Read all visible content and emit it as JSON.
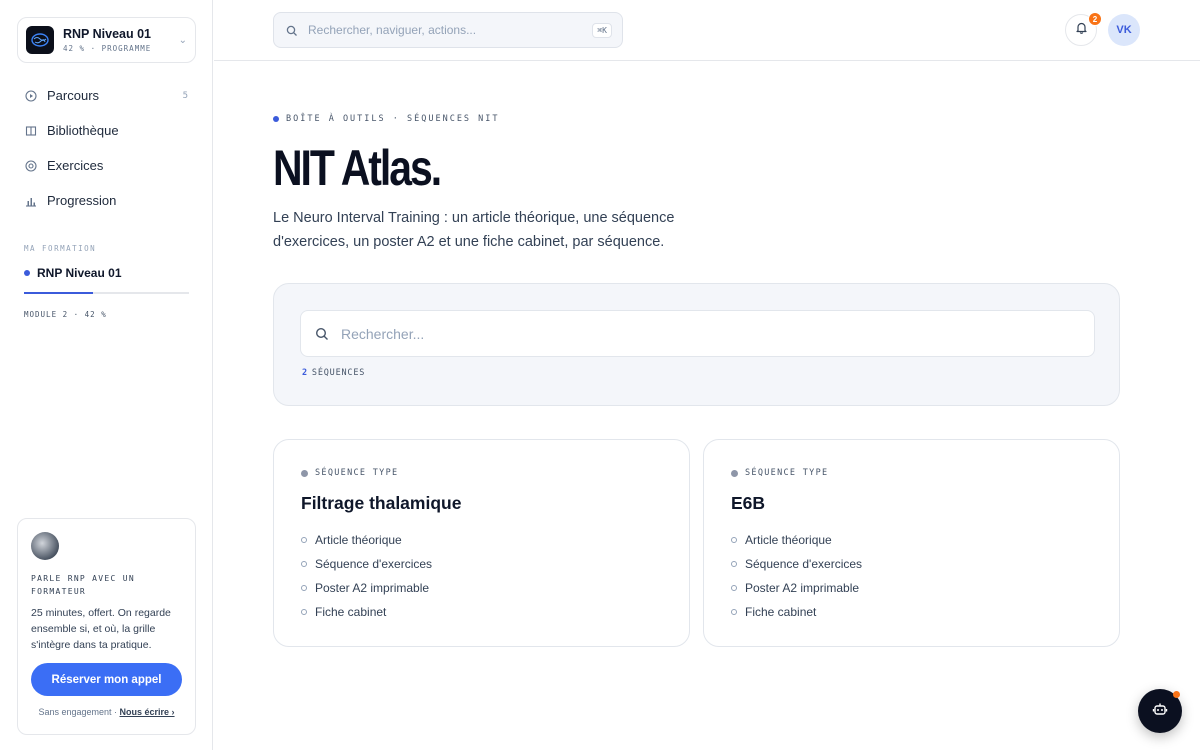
{
  "program": {
    "name": "RNP Niveau 01",
    "meta": "42 % · PROGRAMME"
  },
  "nav": [
    {
      "label": "Parcours",
      "count": "5",
      "icon": "play-circle-icon"
    },
    {
      "label": "Bibliothèque",
      "count": "",
      "icon": "book-icon"
    },
    {
      "label": "Exercices",
      "count": "",
      "icon": "target-icon"
    },
    {
      "label": "Progression",
      "count": "",
      "icon": "bar-chart-icon"
    }
  ],
  "formation": {
    "section_label": "MA FORMATION",
    "name": "RNP Niveau 01",
    "progress": 0.42,
    "module_label": "MODULE 2 · 42 %"
  },
  "call": {
    "title": "PARLE RNP AVEC UN FORMATEUR",
    "desc": "25 minutes, offert. On regarde ensemble si, et où, la grille s'intègre dans ta pratique.",
    "button": "Réserver mon appel",
    "foot_text": "Sans engagement · ",
    "foot_link": "Nous écrire ›"
  },
  "topbar": {
    "search_placeholder": "Rechercher, naviguer, actions...",
    "shortcut": "⌘K",
    "notifications": "2",
    "user_initials": "VK"
  },
  "main": {
    "eyebrow": "BOÎTE À OUTILS · SÉQUENCES NIT",
    "title": "NIT Atlas.",
    "desc": "Le Neuro Interval Training : un article théorique, une séquence d'exercices, un poster A2 et une fiche cabinet, par séquence.",
    "search_placeholder": "Rechercher...",
    "count": "2",
    "count_label": "SÉQUENCES"
  },
  "cards": [
    {
      "type": "SÉQUENCE TYPE",
      "title": "Filtrage thalamique",
      "items": [
        "Article théorique",
        "Séquence d'exercices",
        "Poster A2 imprimable",
        "Fiche cabinet"
      ]
    },
    {
      "type": "SÉQUENCE TYPE",
      "title": "E6B",
      "items": [
        "Article théorique",
        "Séquence d'exercices",
        "Poster A2 imprimable",
        "Fiche cabinet"
      ]
    }
  ],
  "colors": {
    "accent": "#3b6ef5",
    "badge": "#f97316",
    "dark": "#0b1020"
  }
}
